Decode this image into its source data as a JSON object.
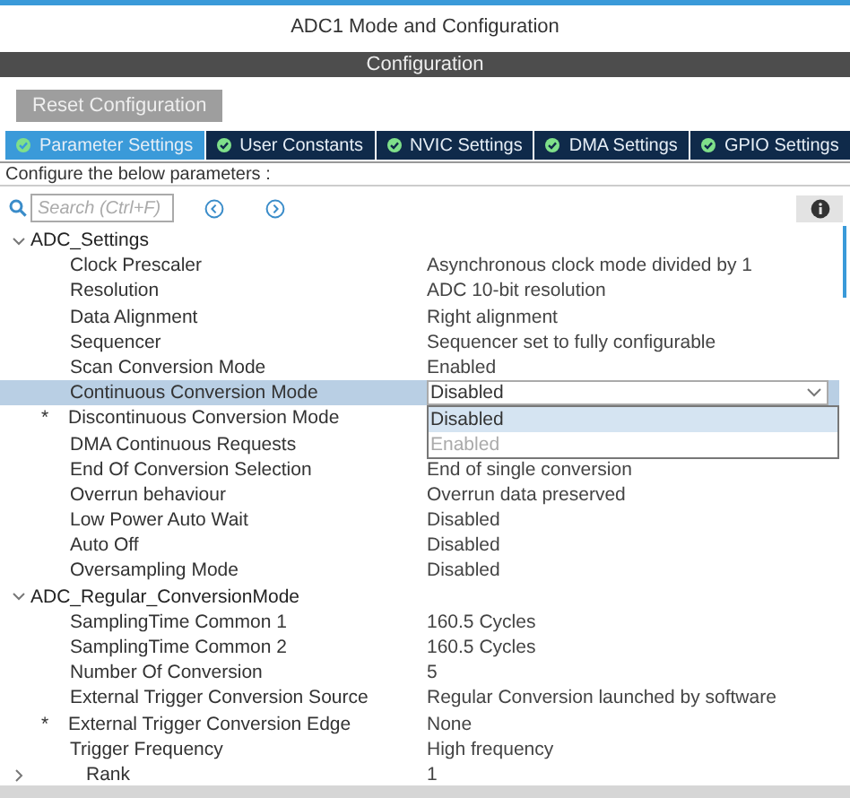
{
  "window": {
    "title": "ADC1 Mode and Configuration"
  },
  "section": {
    "title": "Configuration"
  },
  "reset_button": "Reset Configuration",
  "tabs": [
    {
      "label": "Parameter Settings",
      "selected": true
    },
    {
      "label": "User Constants",
      "selected": false
    },
    {
      "label": "NVIC Settings",
      "selected": false
    },
    {
      "label": "DMA Settings",
      "selected": false
    },
    {
      "label": "GPIO Settings",
      "selected": false
    }
  ],
  "instructions": "Configure the below parameters :",
  "search": {
    "placeholder": "Search (Ctrl+F)"
  },
  "tree": [
    {
      "label": "ADC_Settings",
      "expanded": true,
      "children": [
        {
          "kind": "param",
          "label": "Clock Prescaler",
          "value": "Asynchronous clock mode divided by 1",
          "selected": false
        },
        {
          "kind": "param",
          "label": "Resolution",
          "value": "ADC 10-bit resolution",
          "selected": false
        },
        {
          "kind": "param",
          "label": "Data Alignment",
          "value": "Right alignment",
          "selected": false
        },
        {
          "kind": "param",
          "label": "Sequencer",
          "value": "Sequencer set to fully configurable",
          "selected": false
        },
        {
          "kind": "param",
          "label": "Scan Conversion Mode",
          "value": "Enabled",
          "selected": false
        },
        {
          "kind": "param",
          "label": "Continuous Conversion Mode",
          "value": "Disabled",
          "selected": true,
          "dropdown": {
            "options": [
              {
                "label": "Disabled",
                "selected": true,
                "disabled": false
              },
              {
                "label": "Enabled",
                "selected": false,
                "disabled": true
              }
            ]
          }
        },
        {
          "kind": "param",
          "label": "Discontinuous Conversion Mode",
          "selected": false,
          "marker": "*"
        },
        {
          "kind": "param",
          "label": "DMA Continuous Requests",
          "selected": false
        },
        {
          "kind": "param",
          "label": "End Of Conversion Selection",
          "value": "End of single conversion",
          "selected": false
        },
        {
          "kind": "param",
          "label": "Overrun behaviour",
          "value": "Overrun data preserved",
          "selected": false
        },
        {
          "kind": "param",
          "label": "Low Power Auto Wait",
          "value": "Disabled",
          "selected": false
        },
        {
          "kind": "param",
          "label": "Auto Off",
          "value": "Disabled",
          "selected": false
        },
        {
          "kind": "param",
          "label": "Oversampling Mode",
          "value": "Disabled",
          "selected": false
        }
      ]
    },
    {
      "label": "ADC_Regular_ConversionMode",
      "expanded": true,
      "children": [
        {
          "kind": "param",
          "label": "SamplingTime Common 1",
          "value": "160.5 Cycles",
          "selected": false
        },
        {
          "kind": "param",
          "label": "SamplingTime Common 2",
          "value": "160.5 Cycles",
          "selected": false
        },
        {
          "kind": "param",
          "label": "Number Of Conversion",
          "value": "5",
          "selected": false
        },
        {
          "kind": "param",
          "label": "External Trigger Conversion Source",
          "value": "Regular Conversion launched by software",
          "selected": false
        },
        {
          "kind": "param",
          "label": "External Trigger Conversion Edge",
          "value": "None",
          "selected": false,
          "marker": "*"
        },
        {
          "kind": "param",
          "label": "Trigger Frequency",
          "value": "High frequency",
          "selected": false
        },
        {
          "kind": "group",
          "label": "Rank",
          "value": "1",
          "selected": false,
          "expanded": false
        }
      ]
    }
  ]
}
